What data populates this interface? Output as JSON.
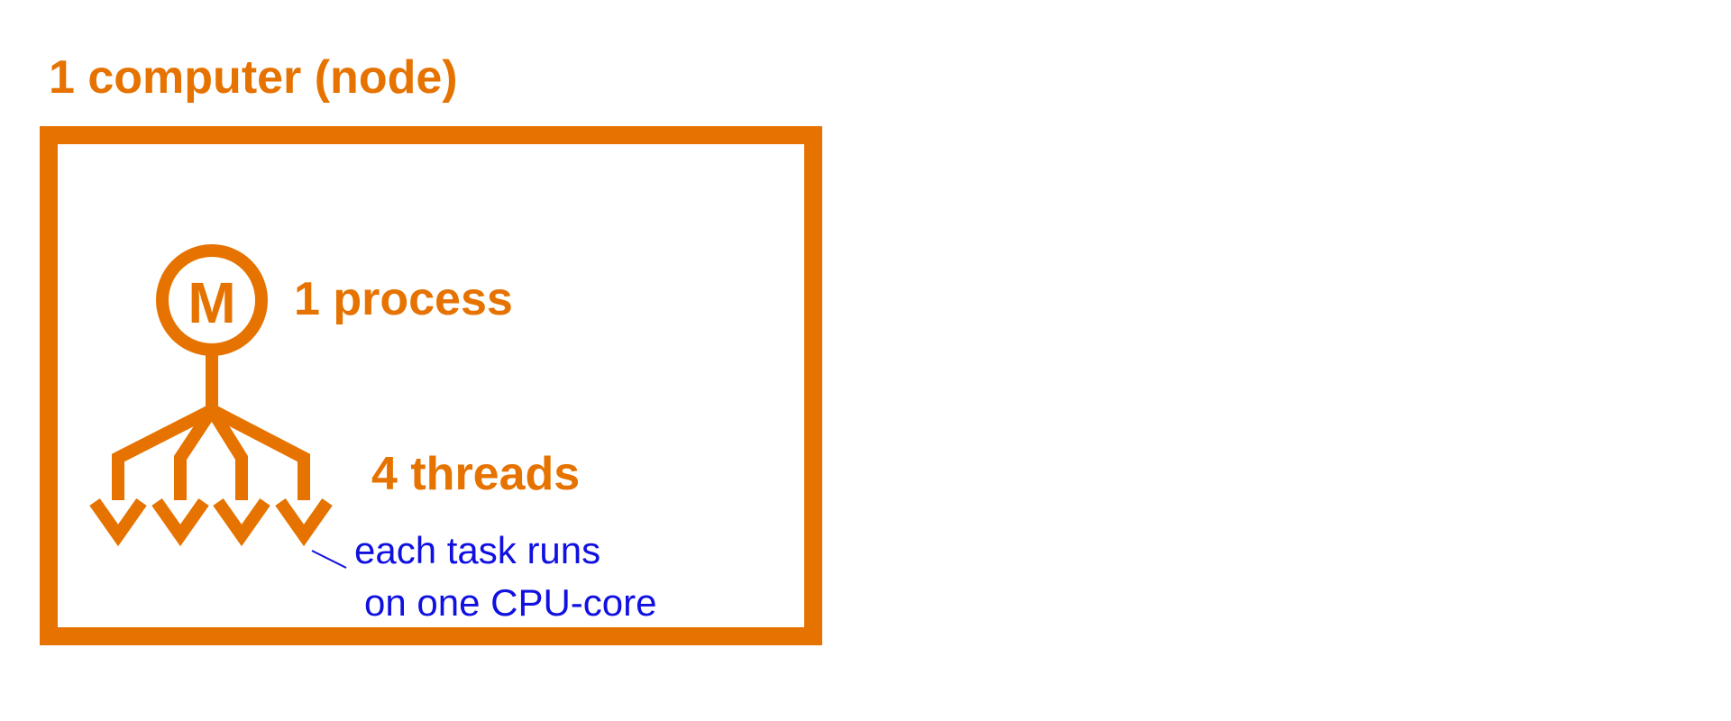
{
  "node": {
    "title": "1 computer (node)"
  },
  "process": {
    "icon_letter": "M",
    "label": "1 process"
  },
  "threads": {
    "label": "4 threads",
    "count": 4
  },
  "note": {
    "line1": "each task runs",
    "line2": "on one CPU-core"
  },
  "colors": {
    "primary": "#e67300",
    "note": "#1010e0",
    "background": "#ffffff"
  }
}
